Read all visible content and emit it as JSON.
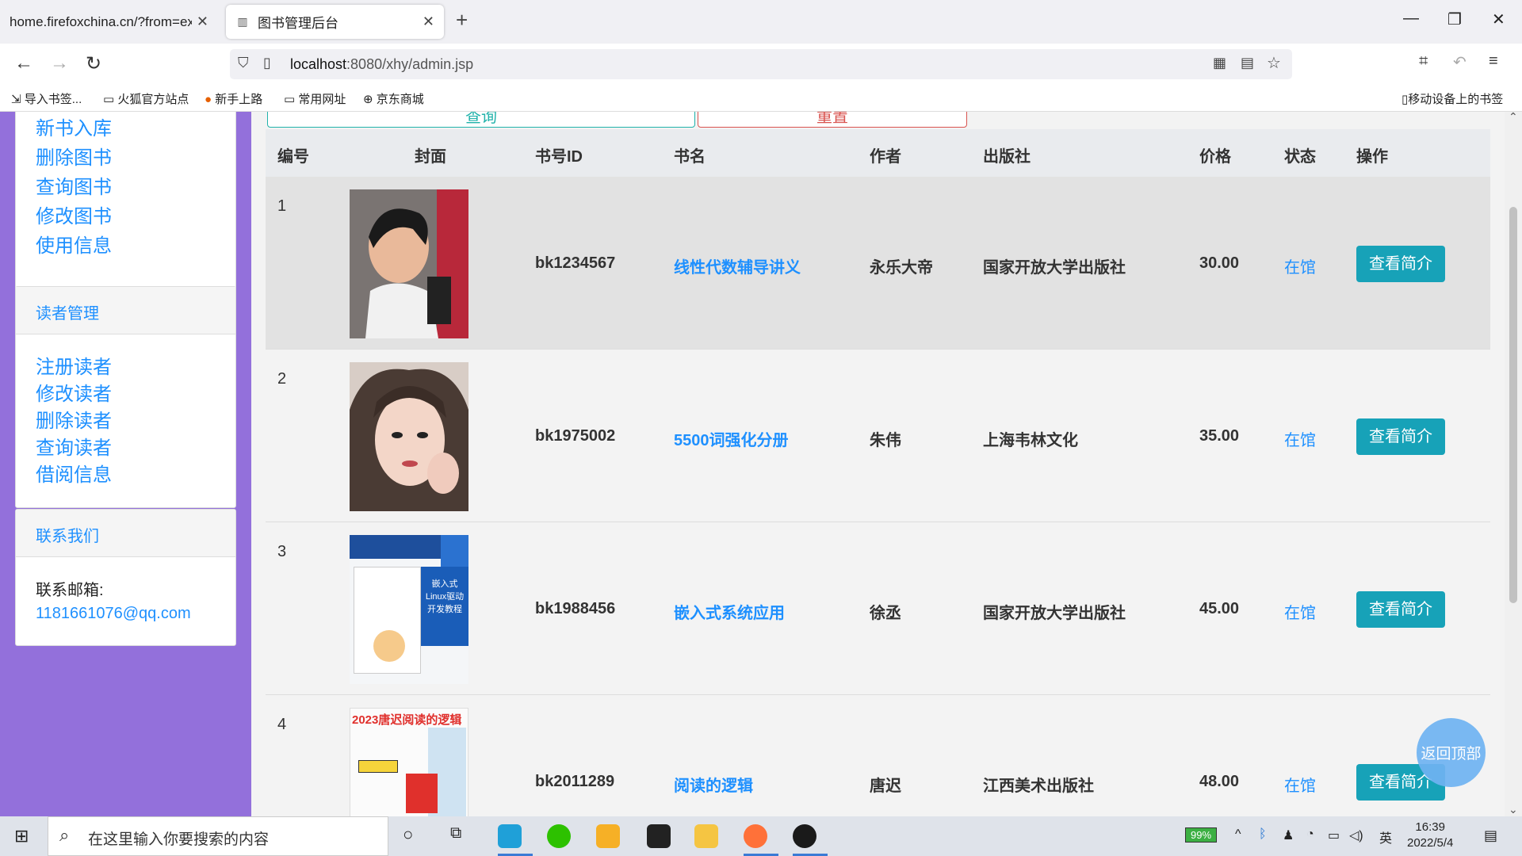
{
  "browser": {
    "tabs": [
      {
        "title": "home.firefoxchina.cn/?from=extra_start"
      },
      {
        "title": "图书管理后台"
      }
    ],
    "url_host": "localhost",
    "url_rest": ":8080/xhy/admin.jsp",
    "bookmarks": [
      "导入书签...",
      "火狐官方站点",
      "新手上路",
      "常用网址",
      "京东商城"
    ],
    "mobile_bookmarks": "移动设备上的书签"
  },
  "sidebar": {
    "book_links": [
      "新书入库",
      "删除图书",
      "查询图书",
      "修改图书",
      "使用信息"
    ],
    "reader_header": "读者管理",
    "reader_links": [
      "注册读者",
      "修改读者",
      "删除读者",
      "查询读者",
      "借阅信息"
    ],
    "contact_header": "联系我们",
    "contact_label": "联系邮箱:",
    "contact_email": "1181661076@qq.com"
  },
  "actions": {
    "search": "查询",
    "reset": "重置"
  },
  "table": {
    "headers": [
      "编号",
      "封面",
      "书号ID",
      "书名",
      "作者",
      "出版社",
      "价格",
      "状态",
      "操作"
    ],
    "rows": [
      {
        "num": "1",
        "id": "bk1234567",
        "name": "线性代数辅导讲义",
        "author": "永乐大帝",
        "publisher": "国家开放大学出版社",
        "price": "30.00",
        "status": "在馆",
        "action": "查看简介"
      },
      {
        "num": "2",
        "id": "bk1975002",
        "name": "5500词强化分册",
        "author": "朱伟",
        "publisher": "上海韦林文化",
        "price": "35.00",
        "status": "在馆",
        "action": "查看简介"
      },
      {
        "num": "3",
        "id": "bk1988456",
        "name": "嵌入式系统应用",
        "author": "徐丞",
        "publisher": "国家开放大学出版社",
        "price": "45.00",
        "status": "在馆",
        "action": "查看简介"
      },
      {
        "num": "4",
        "id": "bk2011289",
        "name": "阅读的逻辑",
        "author": "唐迟",
        "publisher": "江西美术出版社",
        "price": "48.00",
        "status": "在馆",
        "action": "查看简介"
      }
    ],
    "cover3_text": [
      "嵌入式",
      "Linux驱动",
      "开发教程"
    ],
    "cover4_text": "2023唐迟阅读的逻辑"
  },
  "back_to_top": "返回顶部",
  "taskbar": {
    "search_placeholder": "在这里输入你要搜索的内容",
    "battery": "99%",
    "ime": "英",
    "time": "16:39",
    "date": "2022/5/4"
  },
  "colors": {
    "sidebar": "#9370db",
    "link": "#1e90ff",
    "action_button": "#17a2b8"
  }
}
